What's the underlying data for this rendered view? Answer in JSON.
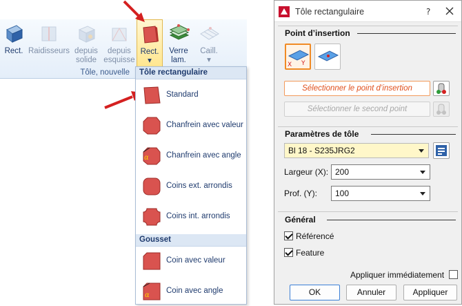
{
  "ribbon": {
    "buttons": [
      {
        "label": "Rect.",
        "label2": "",
        "disabled": false
      },
      {
        "label": "Raidisseurs",
        "label2": "",
        "disabled": true
      },
      {
        "label": "depuis",
        "label2": "solide",
        "disabled": true
      },
      {
        "label": "depuis",
        "label2": "esquisse",
        "disabled": true
      },
      {
        "label": "Rect.",
        "label2": "▾",
        "disabled": false
      },
      {
        "label": "Verre",
        "label2": "lam.",
        "disabled": false
      },
      {
        "label": "Caill.",
        "label2": "▾",
        "disabled": true
      }
    ],
    "group_label": "Tôle, nouvelle"
  },
  "menu": {
    "header1": "Tôle rectangulaire",
    "items1": [
      "Standard",
      "Chanfrein avec valeur",
      "Chanfrein avec angle",
      "Coins ext. arrondis",
      "Coins int. arrondis"
    ],
    "header2": "Gousset",
    "items2": [
      "Coin avec valeur",
      "Coin avec angle"
    ]
  },
  "dialog": {
    "title": "Tôle rectangulaire",
    "insertion": {
      "title": "Point d’insertion",
      "select_first": "Sélectionner le point d’insertion",
      "select_second": "Sélectionner le second point"
    },
    "params": {
      "title": "Paramètres de tôle",
      "material": "Bl 18 - S235JRG2",
      "width_label": "Largeur (X):",
      "width_value": "200",
      "depth_label": "Prof. (Y):",
      "depth_value": "100"
    },
    "general": {
      "title": "Général",
      "referenced_label": "Référencé",
      "referenced_checked": true,
      "feature_label": "Feature",
      "feature_checked": true
    },
    "apply_immediately_label": "Appliquer immédiatement",
    "apply_immediately_checked": false,
    "buttons": {
      "ok": "OK",
      "cancel": "Annuler",
      "apply": "Appliquer"
    }
  },
  "colors": {
    "accent_orange": "#f08a24",
    "plate_red": "#d9534f",
    "ribbon_blue": "#1f3b6e"
  }
}
